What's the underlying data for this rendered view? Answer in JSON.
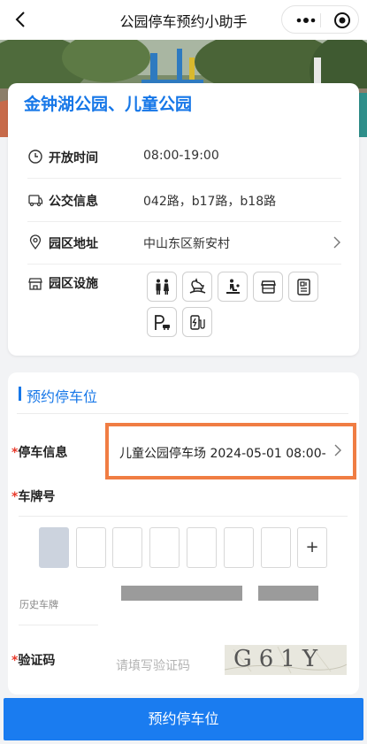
{
  "navbar": {
    "title": "公园停车预约小助手"
  },
  "park": {
    "name": "金钟湖公园、儿童公园",
    "rows": [
      {
        "icon": "clock-icon",
        "label": "开放时间",
        "value": "08:00-19:00"
      },
      {
        "icon": "bus-icon",
        "label": "公交信息",
        "value": "042路，b17路，b18路"
      },
      {
        "icon": "location-pin-icon",
        "label": "园区地址",
        "value": "中山东区新安村"
      }
    ],
    "facilities_label": "园区设施",
    "facility_icons": [
      "restroom-icon",
      "rocking-horse-icon",
      "baby-care-icon",
      "shop-icon",
      "info-board-icon",
      "parking-icon",
      "ev-charging-icon"
    ]
  },
  "booking": {
    "section_title": "预约停车位",
    "required_mark": "*",
    "parking_label": "停车信息",
    "parking_value": "儿童公园停车场 2024-05-01 08:00-",
    "plate_label": "车牌号",
    "plate_add": "+",
    "history_label": "历史车牌",
    "code_label": "验证码",
    "code_placeholder": "请填写验证码",
    "captcha_text": "G61Y"
  },
  "submit_label": "预约停车位",
  "colors": {
    "accent": "#1677e8",
    "button": "#1a7cf0",
    "highlight": "#f07d43",
    "required": "#e83a2b"
  }
}
